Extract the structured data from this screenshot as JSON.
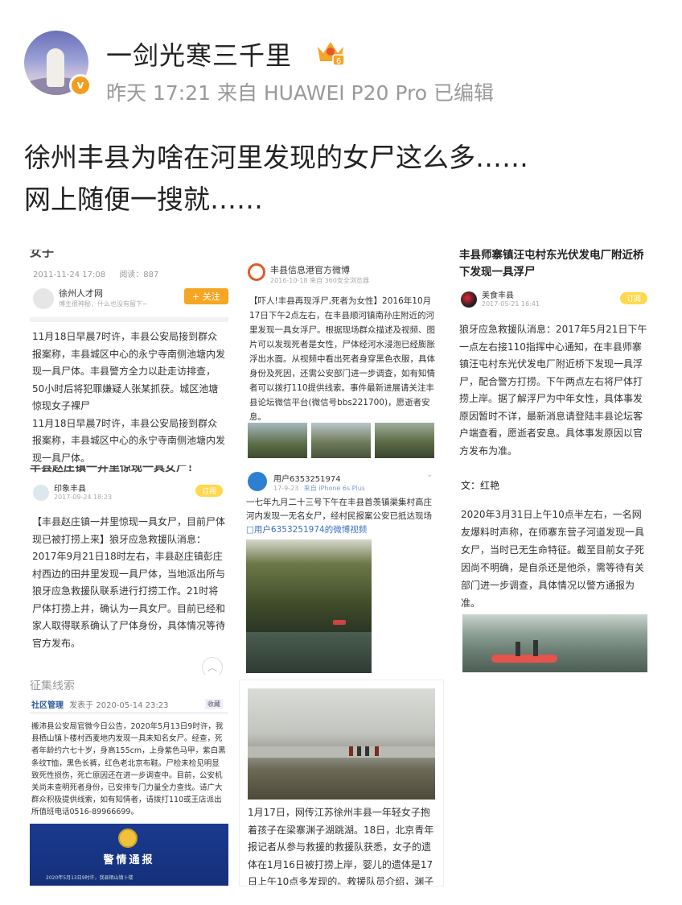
{
  "post": {
    "username": "一剑光寒三千里",
    "level_badge": "6",
    "verified_mark": "v",
    "meta": "昨天 17:21 来自 HUAWEI P20 Pro 已编辑",
    "text_line1": "徐州丰县为啥在河里发现的女尸这么多……",
    "text_line2": "网上随便一搜就……"
  },
  "images": {
    "img1": {
      "top_cut": "女子",
      "date": "2011-11-24 17:08",
      "reads": "阅读：887",
      "account": "徐州人才网",
      "account_sub": "博主很神秘，什么也没有留下~",
      "follow": "+ 关注",
      "body": "11月18日早晨7时许，丰县公安局接到群众报案称，丰县城区中心的永宁寺南侧池塘内发现一具尸体。丰县警方全力以赴走访排查，50小时后将犯罪嫌疑人张某抓获。城区池塘惊现女子裸尸\n11月18日早晨7时许，丰县公安局接到群众报案称，丰县城区中心的永宁寺南侧池塘内发现一具尸体。"
    },
    "img2": {
      "account": "丰县信息港官方微博",
      "date": "2016-10-18 来自 360安全浏览器",
      "body": "【吓人!丰县再现浮尸,死者为女性】2016年10月17日下午2点左右，在丰县顺河镇南孙庄附近的河里发现一具女浮尸。根据现场群众描述及视频、图片可以发现死者是女性，尸体经河水浸泡已经膨胀浮出水面。从视频中看出死者身穿黑色衣服，具体身份及死因，还需公安部门进一步调查，如有知情者可以拨打110提供线索。事件最新进展请关注丰县论坛微信平台(微信号bbs221700)，愿逝者安息。"
    },
    "img3": {
      "title": "丰县师寨镇汪屯村东光伏发电厂附近桥下发现一具浮尸",
      "account": "美食丰县",
      "date": "2017-05-21 16:41",
      "subscribe": "订阅",
      "body": "狼牙应急救援队消息：2017年5月21日下午一点左右接110指挥中心通知，在丰县师寨镇汪屯村东光伏发电厂附近桥下发现一具浮尸，配合警方打捞。下午两点左右将尸体打捞上岸。据了解浮尸为中年女性，具体事发原因暂时不详，最新消息请登陆丰县论坛客户端查看，愿逝者安息。具体事发原因以官方发布为准。"
    },
    "img4": {
      "top_cut": "丰县赵庄镇一井里惊现一具女尸！",
      "account": "印象丰县",
      "date": "2017-09-24 18:23",
      "subscribe": "订阅",
      "body": "【丰县赵庄镇一井里惊现一具女尸，目前尸体现已被打捞上来】狼牙应急救援队消息：2017年9月21日18时左右，丰县赵庄镇彭庄村西边的田井里发现一具尸体，当地派出所与狼牙应急救援队联系进行打捞工作。21时将尸体打捞上井，确认为一具女尸。目前已经和家人取得联系确认了尸体身份，具体情况等待官方发布。"
    },
    "img5": {
      "account": "用户6353251974",
      "date": "17-9-23",
      "source": "来自 iPhone 6s Plus",
      "body": "一七年九月二十三号下午在丰县首羡镇渠集村高庄河内发现一无名女尸，经村民报案公安已抵达现场",
      "link": "用户6353251974的微博视频"
    },
    "img6": {
      "author": "文：红艳",
      "body": "2020年3月31日上午10点半左右，一名网友爆料时声称，在师寨东营子河道发现一具女尸，当时已无生命特征。截至目前女子死因尚不明确，是自杀还是他杀，需等待有关部门进一步调查，具体情况以警方通报为准。"
    },
    "img7": {
      "top_cut": "征集线索",
      "category": "社区管理",
      "published": "发表于 2020-05-14 23:23",
      "fav": "收藏",
      "body": "搬沛县公安局官微今日公告，2020年5月13日9时许，我县栖山镇卜楼村西麦地内发现一具未知名女尸。经查，死者年龄约六七十岁，身高155cm，上身紫色马甲，紫白黑条纹T恤，黑色长裤，红色老北京布鞋。尸检未检见明显致死性损伤，死亡原因还在进一步调查中。目前，公安机关尚未查明死者身份，已安排专门力量全力查找。请广大群众积极提供线索，如有知情者，请拨打110或王店派出所值班电话0516-89966699。",
      "banner": "警情通报",
      "banner_sub": "2020年5月13日9时许，我县栖山镇卜楼"
    },
    "img8": {
      "body": "1月17日，网传江苏徐州丰县一年轻女子抱着孩子在梁寨渊子湖跳湖。18日，北京青年报记者从参与救援的救援队获悉，女子的遗体在1月16日被打捞上岸，婴儿的遗体是17日上午10点多发现的。救援队员介绍，渊子"
    }
  }
}
